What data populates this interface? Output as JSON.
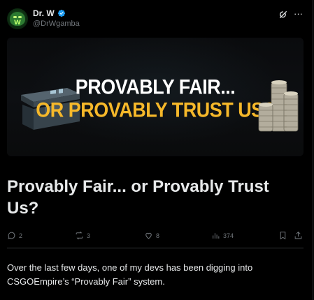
{
  "author": {
    "name": "Dr. W",
    "handle": "@DrWgamba",
    "verified": true,
    "avatar_icon": "avatar-alien-icon"
  },
  "header_icons": [
    "grok-icon",
    "more-icon"
  ],
  "banner": {
    "line1": "PROVABLY FAIR...",
    "line2": "OR PROVABLY TRUST US?",
    "line2_color": "#f6b82a"
  },
  "title": "Provably Fair... or Provably Trust Us?",
  "actions": {
    "replies": "2",
    "reposts": "3",
    "likes": "8",
    "views": "374"
  },
  "body": "Over the last few days, one of my devs has been digging into CSGOEmpire’s “Provably Fair” system.",
  "colors": {
    "background": "#000000",
    "text": "#e7e9ea",
    "muted": "#71767b",
    "verified": "#1d9bf0",
    "divider": "#2f3336"
  }
}
